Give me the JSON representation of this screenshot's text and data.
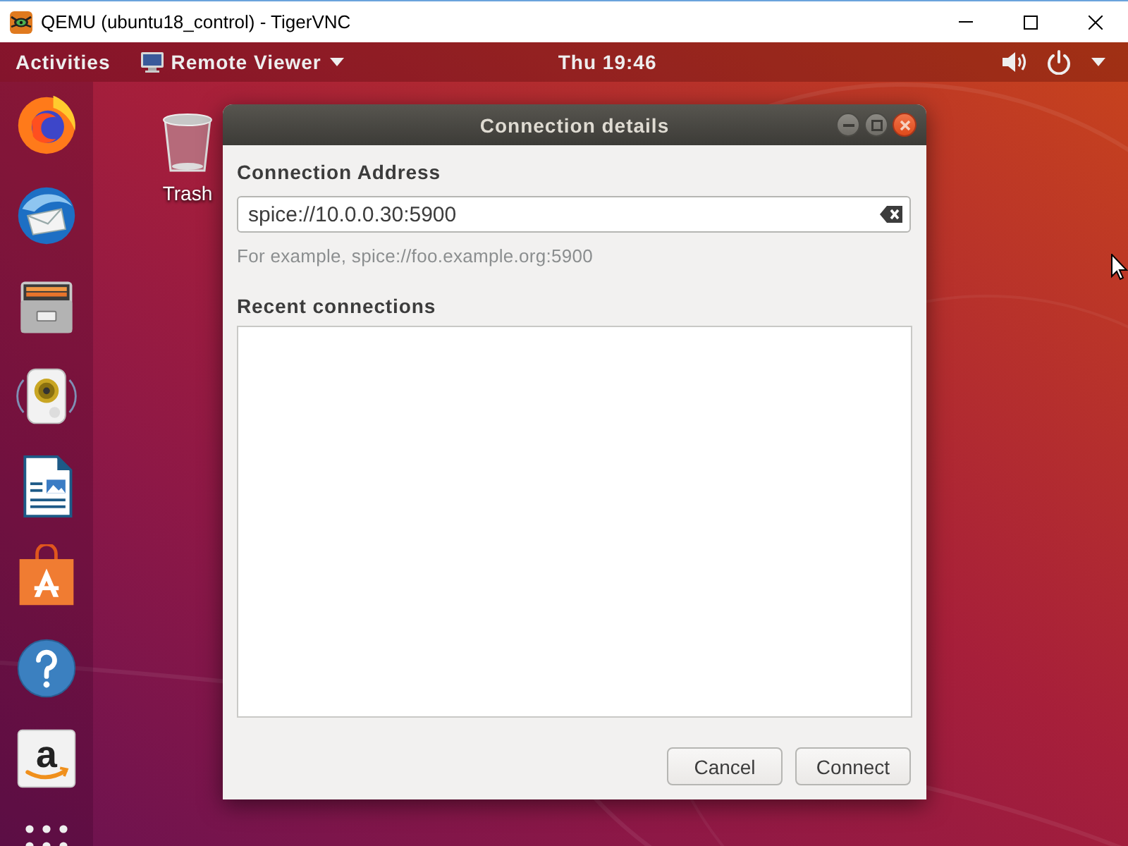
{
  "window": {
    "title": "QEMU (ubuntu18_control) - TigerVNC"
  },
  "top_bar": {
    "activities": "Activities",
    "app_menu": "Remote Viewer",
    "clock": "Thu 19:46"
  },
  "dock": {
    "store_icon_letter": "a"
  },
  "desktop_icons": [
    {
      "label": "Trash"
    }
  ],
  "dialog": {
    "title": "Connection details",
    "address_label": "Connection Address",
    "address_field": {
      "value": "spice://10.0.0.30:5900"
    },
    "hint": "For example, spice://foo.example.org:5900",
    "recent_label": "Recent connections",
    "buttons": [
      "Cancel",
      "Connect"
    ]
  }
}
